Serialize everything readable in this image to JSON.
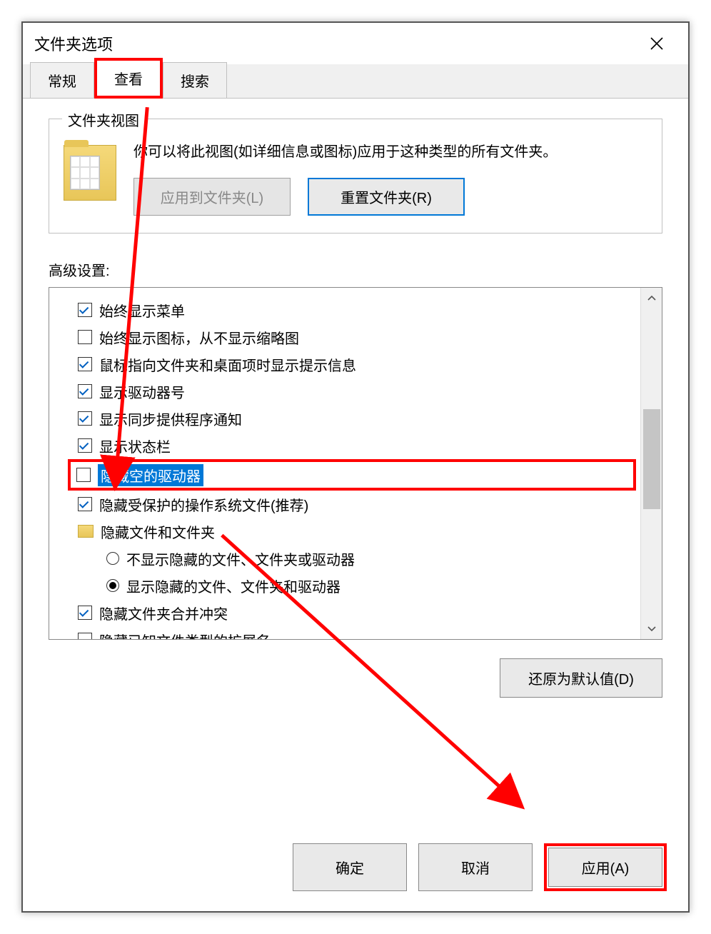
{
  "dialog": {
    "title": "文件夹选项",
    "tabs": {
      "general": "常规",
      "view": "查看",
      "search": "搜索"
    },
    "groupbox": {
      "title": "文件夹视图",
      "desc": "你可以将此视图(如详细信息或图标)应用于这种类型的所有文件夹。",
      "apply_btn": "应用到文件夹(L)",
      "reset_btn": "重置文件夹(R)"
    },
    "advanced": {
      "label": "高级设置:",
      "items": [
        {
          "type": "checkbox",
          "checked": true,
          "label": "始终显示菜单"
        },
        {
          "type": "checkbox",
          "checked": false,
          "label": "始终显示图标，从不显示缩略图"
        },
        {
          "type": "checkbox",
          "checked": true,
          "label": "鼠标指向文件夹和桌面项时显示提示信息"
        },
        {
          "type": "checkbox",
          "checked": true,
          "label": "显示驱动器号"
        },
        {
          "type": "checkbox",
          "checked": true,
          "label": "显示同步提供程序通知"
        },
        {
          "type": "checkbox",
          "checked": true,
          "label": "显示状态栏"
        },
        {
          "type": "checkbox",
          "checked": false,
          "label": "隐藏空的驱动器",
          "highlighted": true
        },
        {
          "type": "checkbox",
          "checked": true,
          "label": "隐藏受保护的操作系统文件(推荐)"
        },
        {
          "type": "folder",
          "label": "隐藏文件和文件夹"
        },
        {
          "type": "radio",
          "checked": false,
          "label": "不显示隐藏的文件、文件夹或驱动器",
          "indent": 2
        },
        {
          "type": "radio",
          "checked": true,
          "label": "显示隐藏的文件、文件夹和驱动器",
          "indent": 2
        },
        {
          "type": "checkbox",
          "checked": true,
          "label": "隐藏文件夹合并冲突"
        },
        {
          "type": "checkbox",
          "checked": false,
          "label": "隐藏已知文件类型的扩展名",
          "cutoff": true
        }
      ],
      "restore_btn": "还原为默认值(D)"
    },
    "footer": {
      "ok": "确定",
      "cancel": "取消",
      "apply": "应用(A)"
    }
  }
}
